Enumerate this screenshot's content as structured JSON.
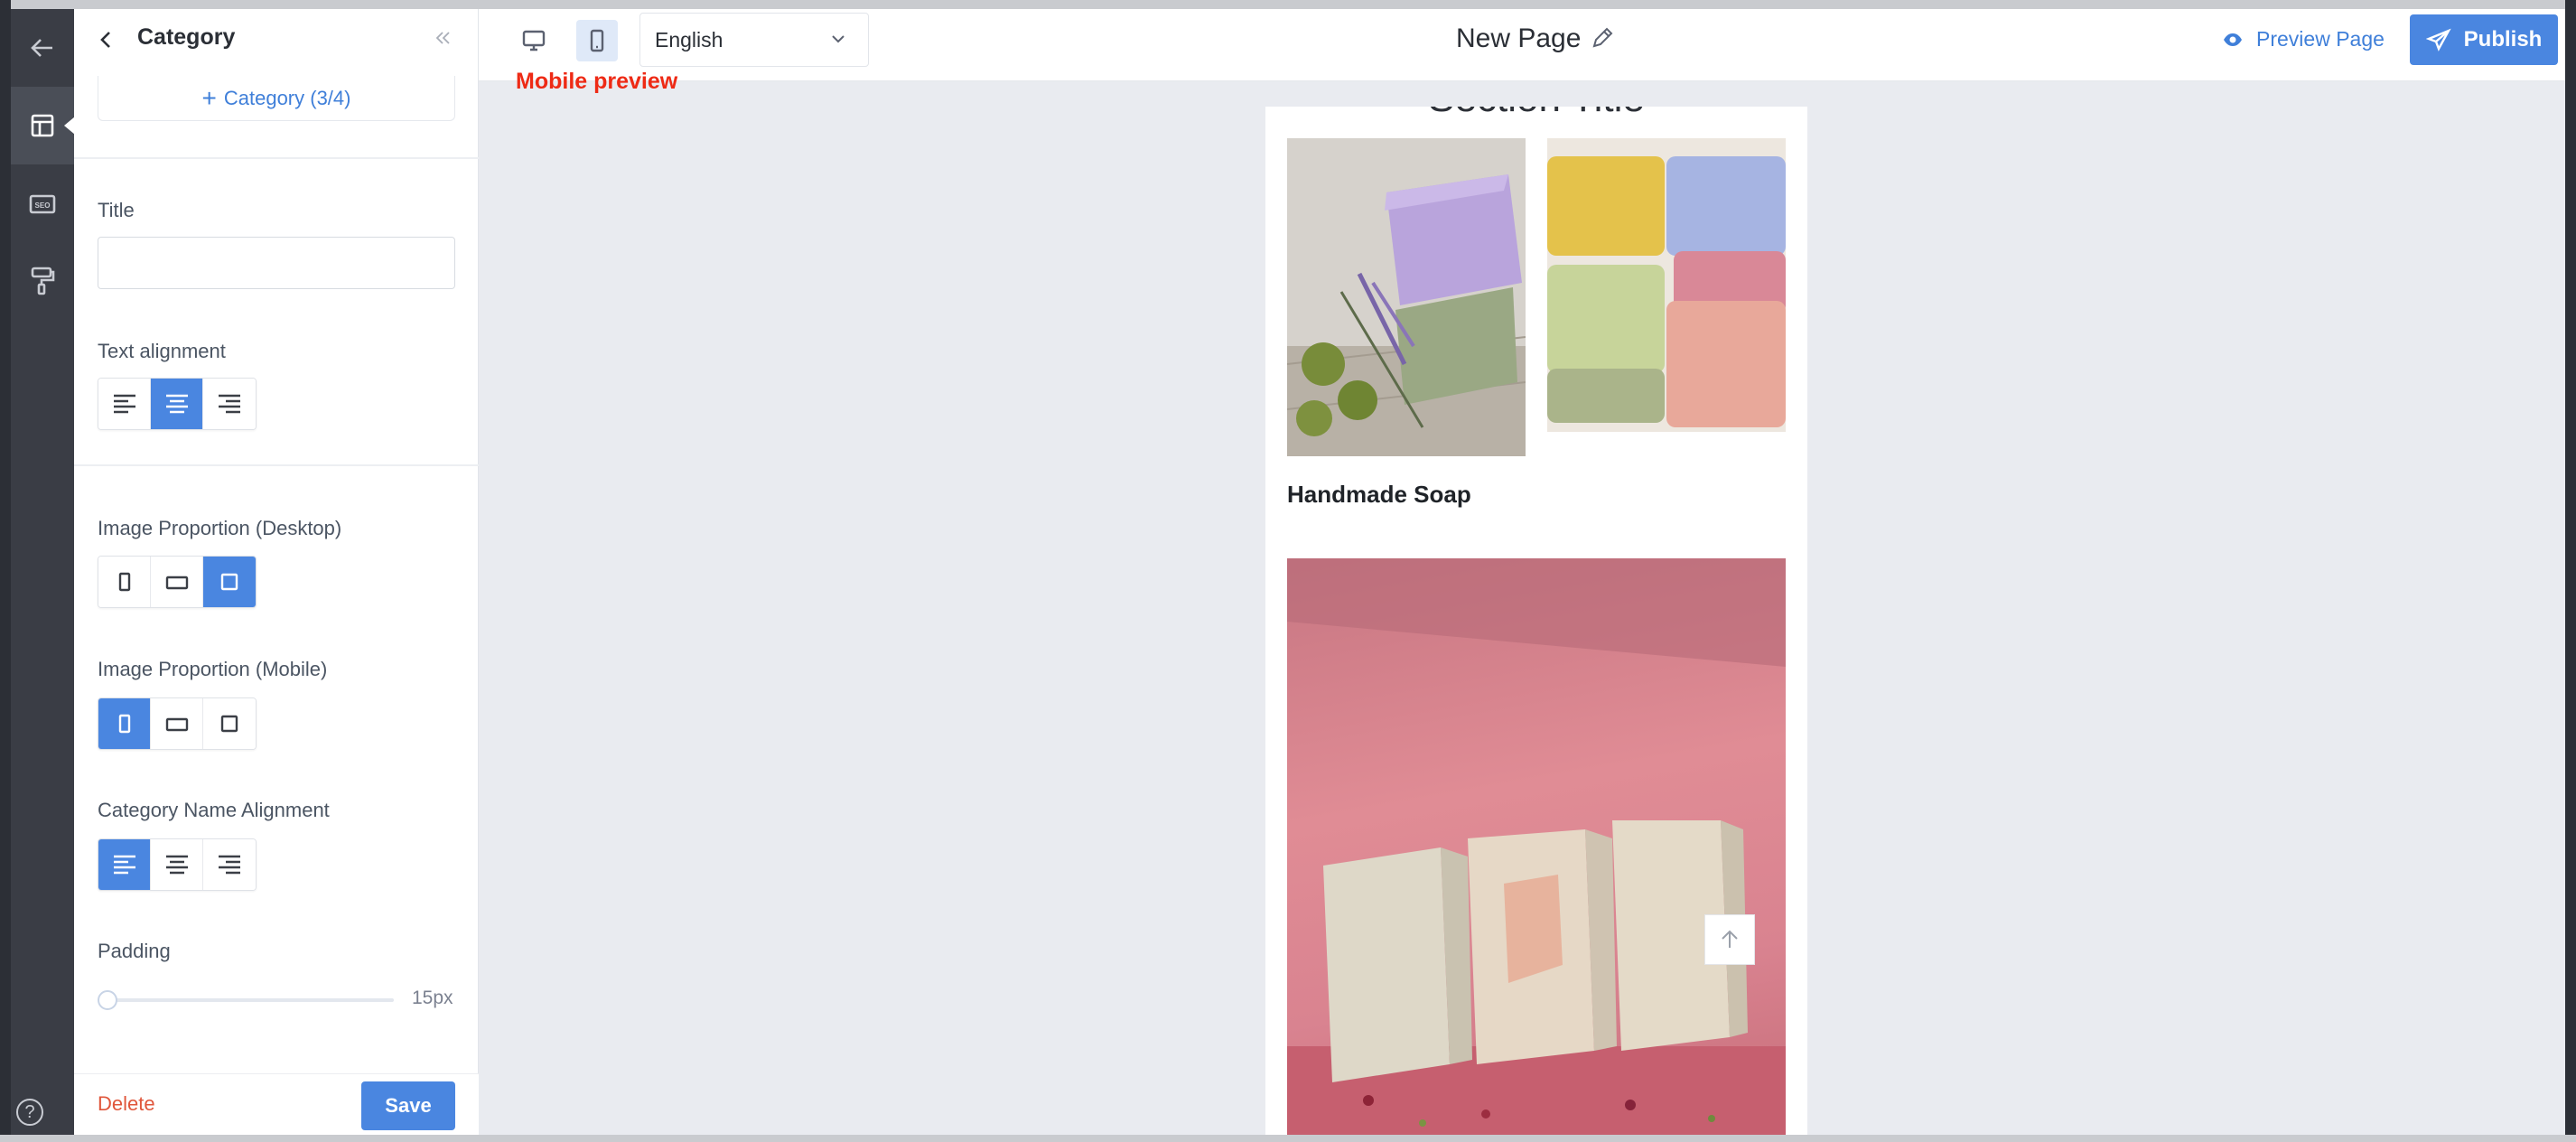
{
  "panel": {
    "title": "Category",
    "add_category_label": "Category (3/4)",
    "title_label": "Title",
    "title_value": "",
    "text_alignment_label": "Text alignment",
    "image_proportion_desktop_label": "Image Proportion (Desktop)",
    "image_proportion_mobile_label": "Image Proportion (Mobile)",
    "category_name_alignment_label": "Category Name Alignment",
    "padding_label": "Padding",
    "padding_value": "15px",
    "delete_label": "Delete",
    "save_label": "Save"
  },
  "topbar": {
    "language": "English",
    "page_name": "New Page",
    "preview_label": "Preview Page",
    "publish_label": "Publish"
  },
  "annotation": "Mobile preview",
  "canvas": {
    "section_title": "Section Title",
    "category_name": "Handmade Soap"
  },
  "rail": {
    "items": [
      "back-icon",
      "layout-icon",
      "seo-icon",
      "paint-roller-icon",
      "help-icon"
    ]
  },
  "colors": {
    "accent": "#4a86e0",
    "annotation": "#ee2a15",
    "rail": "#3a3d45"
  }
}
